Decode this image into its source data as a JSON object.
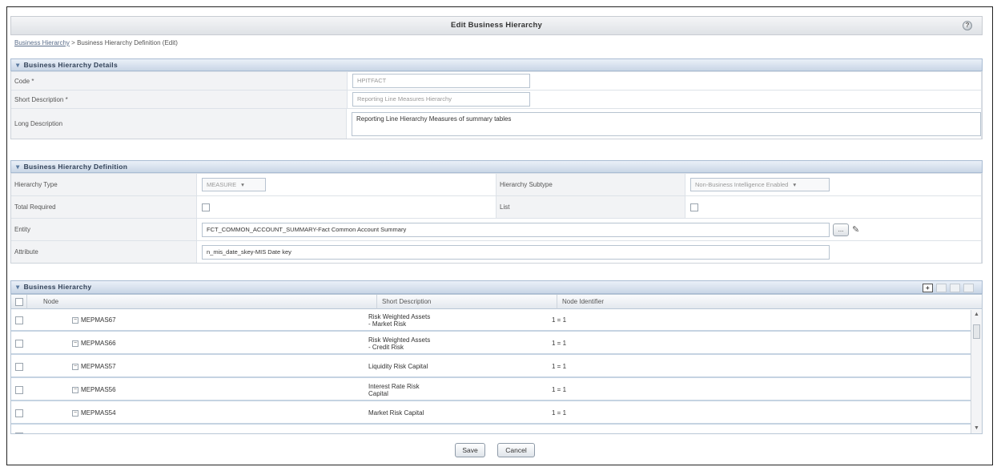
{
  "title": "Edit Business Hierarchy",
  "help_icon": "question-icon",
  "breadcrumb": {
    "link": "Business Hierarchy",
    "separator": ">",
    "current": "Business Hierarchy Definition (Edit)"
  },
  "details": {
    "header": "Business Hierarchy Details",
    "code_label": "Code *",
    "code_value": "HPITFACT",
    "short_desc_label": "Short Description *",
    "short_desc_value": "Reporting Line Measures Hierarchy",
    "long_desc_label": "Long Description",
    "long_desc_value": "Reporting Line Hierarchy Measures of summary tables"
  },
  "definition": {
    "header": "Business Hierarchy Definition",
    "type_label": "Hierarchy Type",
    "type_value": "MEASURE",
    "subtype_label": "Hierarchy Subtype",
    "subtype_value": "Non-Business Intelligence Enabled",
    "total_label": "Total Required",
    "list_label": "List",
    "entity_label": "Entity",
    "entity_value": "FCT_COMMON_ACCOUNT_SUMMARY-Fact Common Account Summary",
    "entity_browse": "...",
    "attribute_label": "Attribute",
    "attribute_value": "n_mis_date_skey-MIS Date key"
  },
  "hierarchy": {
    "header": "Business Hierarchy",
    "columns": [
      "Node",
      "Short Description",
      "Node Identifier"
    ],
    "rows": [
      {
        "node": "MEPMAS67",
        "desc_1": "Risk Weighted Assets",
        "desc_2": "- Market Risk",
        "identifier": "1 = 1"
      },
      {
        "node": "MEPMAS66",
        "desc_1": "Risk Weighted Assets",
        "desc_2": "- Credit Risk",
        "identifier": "1 = 1"
      },
      {
        "node": "MEPMAS57",
        "desc_1": "Liquidity Risk Capital",
        "desc_2": "",
        "identifier": "1 = 1"
      },
      {
        "node": "MEPMAS56",
        "desc_1": "Interest Rate Risk",
        "desc_2": "Capital",
        "identifier": "1 = 1"
      },
      {
        "node": "MEPMAS54",
        "desc_1": "Market Risk Capital",
        "desc_2": "",
        "identifier": "1 = 1"
      }
    ]
  },
  "buttons": {
    "save": "Save",
    "cancel": "Cancel"
  }
}
